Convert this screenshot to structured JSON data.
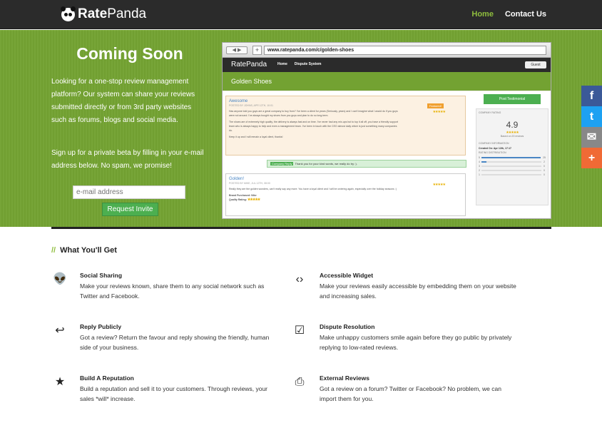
{
  "nav": {
    "logo_rate": "Rate",
    "logo_panda": "Panda",
    "home": "Home",
    "contact": "Contact Us"
  },
  "hero": {
    "title": "Coming Soon",
    "intro": "Looking for a one-stop review management platform? Our system can share your reviews submitted directly or from 3rd party websites such as forums, blogs and social media.",
    "signup": "Sign up for a private beta by filling in your e-mail address below. No spam, we promise!",
    "email_placeholder": "e-mail address",
    "request_button": "Request Invite"
  },
  "browser": {
    "back_forward": "◀ ▶",
    "plus": "+",
    "url": "www.ratepanda.com/c/golden-shoes",
    "inner_logo": "RatePanda",
    "inner_home": "Home",
    "inner_dispute": "Dispute System",
    "guest": "Guest",
    "company": "Golden Shoes",
    "review1": {
      "title": "Awesome",
      "meta": "POSTED BY JOHNS, APR 12TH, 10:01",
      "featured": "Featured!",
      "body1": "Has anyone told you guys are a great company to buy from? I've been a client for years (Seriously, years) and I can't imagine what I would do if you guys were not around. I've always bought my shoes from you guys and plan to do so long-term.",
      "body2": "The shoes are of extremely high quality, the delivery is always fast and on time. I've never had any mix-ups but to top it all off, you have a friendly support team who is always happy to help and even a management team. I've been in touch with the CEO almost daily which is just something many companies do.",
      "body3": "Keep it up and I will remain a loyal client, thanks!"
    },
    "reply": {
      "tag": "Company Reply",
      "text": "Thank you for your kind words, we really do try :)."
    },
    "review2": {
      "title": "Golden!",
      "meta": "POSTED BY MIKE, JUL 12TH, 08:00",
      "body": "Really they are the golden wonders, can't really say any more. You have a loyal client and I will be ordering again, especially over the holiday seasons :)",
      "brand": "Brand Purchased: Nike",
      "quality": "Quality Rating:"
    },
    "post_button": "Post Testimonial",
    "rating_label": "COMPANY RATING",
    "rating_value": "4.9",
    "rating_based": "Based on 20 reviews",
    "info_label": "COMPANY INFORMATION",
    "created": "Created On: Apr 12th, 17:17",
    "distribution_label": "RATING DISTRIBUTION",
    "distribution": [
      {
        "stars": "5",
        "count": "25",
        "fraction": 1.0
      },
      {
        "stars": "4",
        "count": "2",
        "fraction": 0.08
      },
      {
        "stars": "3",
        "count": "0",
        "fraction": 0
      },
      {
        "stars": "2",
        "count": "0",
        "fraction": 0
      },
      {
        "stars": "1",
        "count": "0",
        "fraction": 0
      }
    ]
  },
  "social": {
    "facebook": "f",
    "twitter": "t",
    "email": "✉",
    "plus": "+"
  },
  "features": {
    "heading_slashes": "//",
    "heading": "What You'll Get",
    "items": [
      {
        "icon": "reddit-icon",
        "glyph": "👽",
        "title": "Social Sharing",
        "text": "Make your reviews known, share them to any social network such as Twitter and Facebook."
      },
      {
        "icon": "code-icon",
        "glyph": "‹›",
        "title": "Accessible Widget",
        "text": "Make your reviews easily accessible by embedding them on your website and increasing sales."
      },
      {
        "icon": "reply-icon",
        "glyph": "↩",
        "title": "Reply Publicly",
        "text": "Got a review? Return the favour and reply showing the friendly, human side of your business."
      },
      {
        "icon": "checklist-icon",
        "glyph": "☑",
        "title": "Dispute Resolution",
        "text": "Make unhappy customers smile again before they go public by privately replying to low-rated reviews."
      },
      {
        "icon": "reputation-icon",
        "glyph": "★",
        "title": "Build A Reputation",
        "text": "Build a reputation and sell it to your customers. Through reviews, your sales *will* increase."
      },
      {
        "icon": "external-icon",
        "glyph": "⎙",
        "title": "External Reviews",
        "text": "Got a review on a forum? Twitter or Facebook? No problem, we can import them for you."
      }
    ]
  }
}
